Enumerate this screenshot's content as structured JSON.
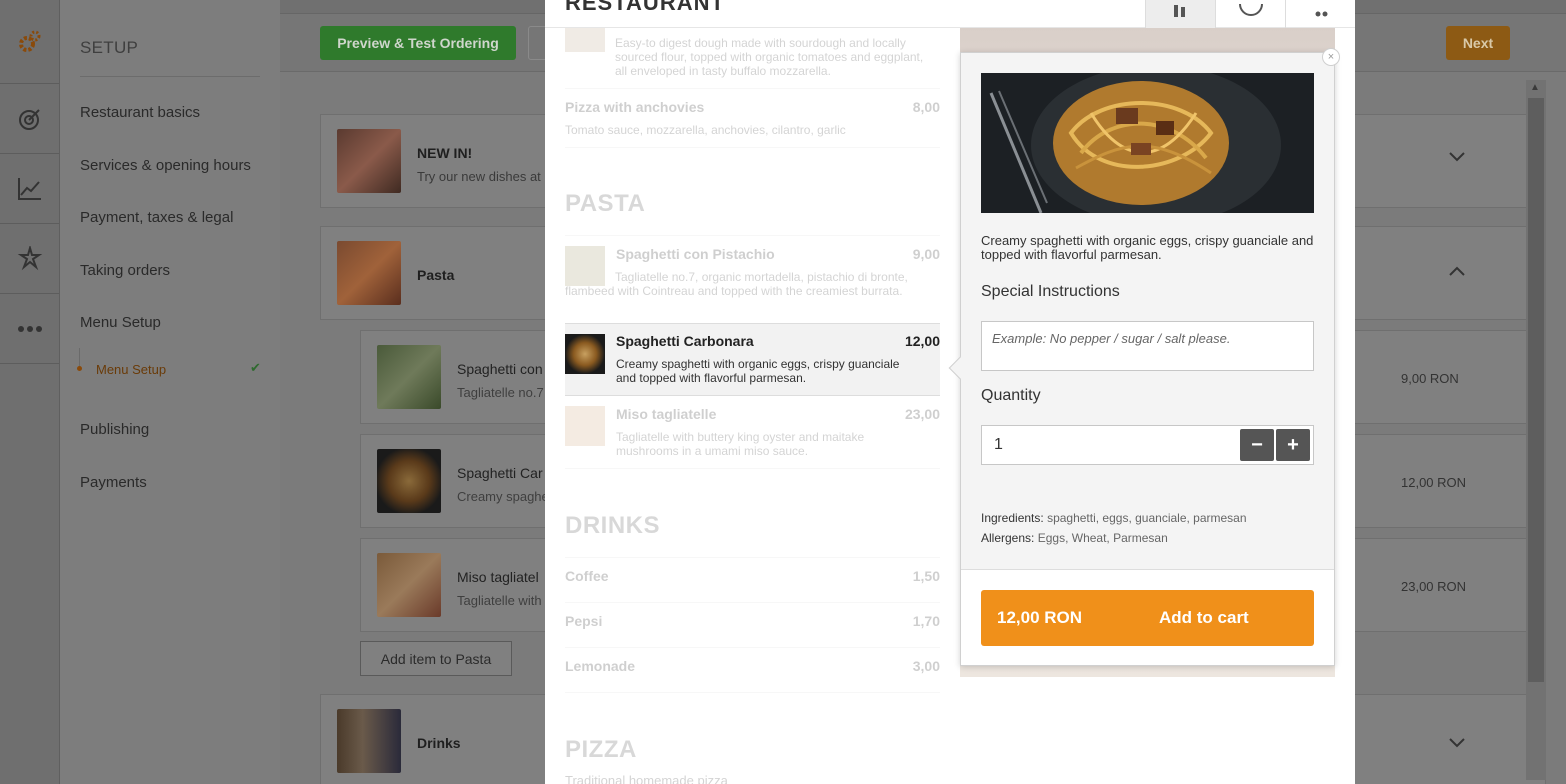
{
  "colors": {
    "accent_orange": "#f0901a",
    "preview_green": "#2f7a2c",
    "overlay": "#7b7b7b"
  },
  "iconbar": {
    "icons": [
      "gear-icon",
      "target-icon",
      "chart-icon",
      "magic-icon",
      "more-icon"
    ]
  },
  "sidebar": {
    "title": "SETUP",
    "items": [
      "Restaurant basics",
      "Services & opening hours",
      "Payment, taxes & legal",
      "Taking orders",
      "Menu Setup",
      "Publishing",
      "Payments"
    ],
    "subitem": "Menu Setup"
  },
  "topbar": {
    "preview_label": "Preview & Test Ordering",
    "next_label": "Next"
  },
  "categories": {
    "new": {
      "title": "NEW IN!",
      "subtitle": "Try our new dishes at"
    },
    "pasta": {
      "title": "Pasta"
    },
    "drinks": {
      "title": "Drinks"
    }
  },
  "admin_dishes": [
    {
      "name": "Spaghetti con",
      "desc": "Tagliatelle no.7",
      "price": "9,00 RON"
    },
    {
      "name": "Spaghetti Car",
      "desc": "Creamy spaghe",
      "price": "12,00 RON"
    },
    {
      "name": "Miso tagliatel",
      "desc": "Tagliatelle with",
      "price": "23,00 RON"
    }
  ],
  "add_item_label": "Add item to Pasta",
  "modal": {
    "title": "RESTAURANT",
    "tabs": [
      "menu-icon",
      "info-icon",
      "cart-icon"
    ],
    "top_item": {
      "desc": "Easy-to digest dough made with sourdough and locally sourced flour, topped with organic tomatoes and eggplant, all enveloped in tasty buffalo mozzarella."
    },
    "anchovies": {
      "name": "Pizza with anchovies",
      "price": "8,00",
      "desc": "Tomato sauce, mozzarella, anchovies, cilantro, garlic"
    },
    "section_pasta": "PASTA",
    "pasta_items": [
      {
        "name": "Spaghetti con Pistachio",
        "price": "9,00",
        "desc": "Tagliatelle no.7, organic mortadella, pistachio di bronte, flambeed with Cointreau and topped with the creamiest burrata."
      },
      {
        "name": "Spaghetti Carbonara",
        "price": "12,00",
        "desc": "Creamy spaghetti with organic eggs, crispy guanciale and topped with flavorful parmesan."
      },
      {
        "name": "Miso tagliatelle",
        "price": "23,00",
        "desc": "Tagliatelle with buttery king oyster and maitake mushrooms in a umami miso sauce."
      }
    ],
    "section_drinks": "DRINKS",
    "drinks": [
      {
        "name": "Coffee",
        "price": "1,50"
      },
      {
        "name": "Pepsi",
        "price": "1,70"
      },
      {
        "name": "Lemonade",
        "price": "3,00"
      }
    ],
    "section_pizza": "PIZZA",
    "pizza_sub": "Traditional homemade pizza"
  },
  "popup": {
    "close": "×",
    "desc": "Creamy spaghetti with organic eggs, crispy guanciale and topped with flavorful parmesan.",
    "special_label": "Special Instructions",
    "special_placeholder": "Example: No pepper / sugar / salt please.",
    "quantity_label": "Quantity",
    "quantity_value": "1",
    "minus": "−",
    "plus": "+",
    "ingredients_label": "Ingredients:",
    "ingredients": "spaghetti, eggs, guanciale, parmesan",
    "allergens_label": "Allergens:",
    "allergens": "Eggs, Wheat, Parmesan",
    "price": "12,00 RON",
    "add_to_cart": "Add to cart"
  }
}
